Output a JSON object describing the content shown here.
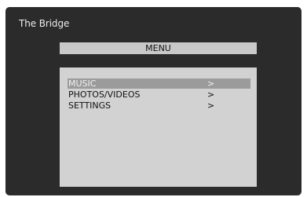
{
  "app": {
    "title": "The Bridge"
  },
  "menu": {
    "header": "MENU",
    "items": [
      {
        "label": "MUSIC",
        "arrow": ">",
        "selected": true
      },
      {
        "label": "PHOTOS/VIDEOS",
        "arrow": ">",
        "selected": false
      },
      {
        "label": "SETTINGS",
        "arrow": ">",
        "selected": false
      }
    ]
  },
  "colors": {
    "screen_background": "#2b2b2b",
    "panel_background": "#d2d2d2",
    "selected_highlight": "#9b9b9b"
  }
}
